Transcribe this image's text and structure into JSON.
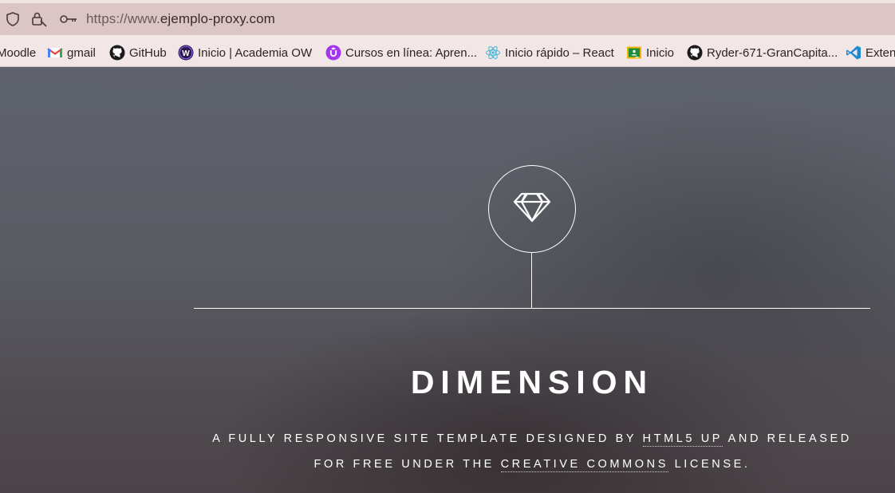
{
  "browser": {
    "url_prefix": "https://www.",
    "url_host": "ejemplo-proxy.com",
    "bookmarks": [
      {
        "label": "Moodle",
        "icon": "moodle-icon"
      },
      {
        "label": "gmail",
        "icon": "gmail-icon"
      },
      {
        "label": "GitHub",
        "icon": "github-icon"
      },
      {
        "label": "Inicio | Academia OW",
        "icon": "academia-ow-icon"
      },
      {
        "label": "Cursos en línea: Apren...",
        "icon": "udemy-icon"
      },
      {
        "label": "Inicio rápido – React",
        "icon": "react-icon"
      },
      {
        "label": "Inicio",
        "icon": "classroom-icon"
      },
      {
        "label": "Ryder-671-GranCapita...",
        "icon": "github-icon"
      },
      {
        "label": "Exten",
        "icon": "vscode-icon"
      }
    ]
  },
  "hero": {
    "logo_icon": "diamond-icon",
    "title": "DIMENSION",
    "tagline_part1": "A FULLY RESPONSIVE SITE TEMPLATE DESIGNED BY ",
    "tagline_link1": "HTML5 UP",
    "tagline_part2": " AND RELEASED",
    "tagline_part3": "FOR FREE UNDER THE ",
    "tagline_link2": "CREATIVE COMMONS",
    "tagline_part4": " LICENSE."
  },
  "colors": {
    "urlbar_bg": "#dcc5c5",
    "bookmarks_bg": "#f2e6e6",
    "page_text": "#ffffff"
  }
}
